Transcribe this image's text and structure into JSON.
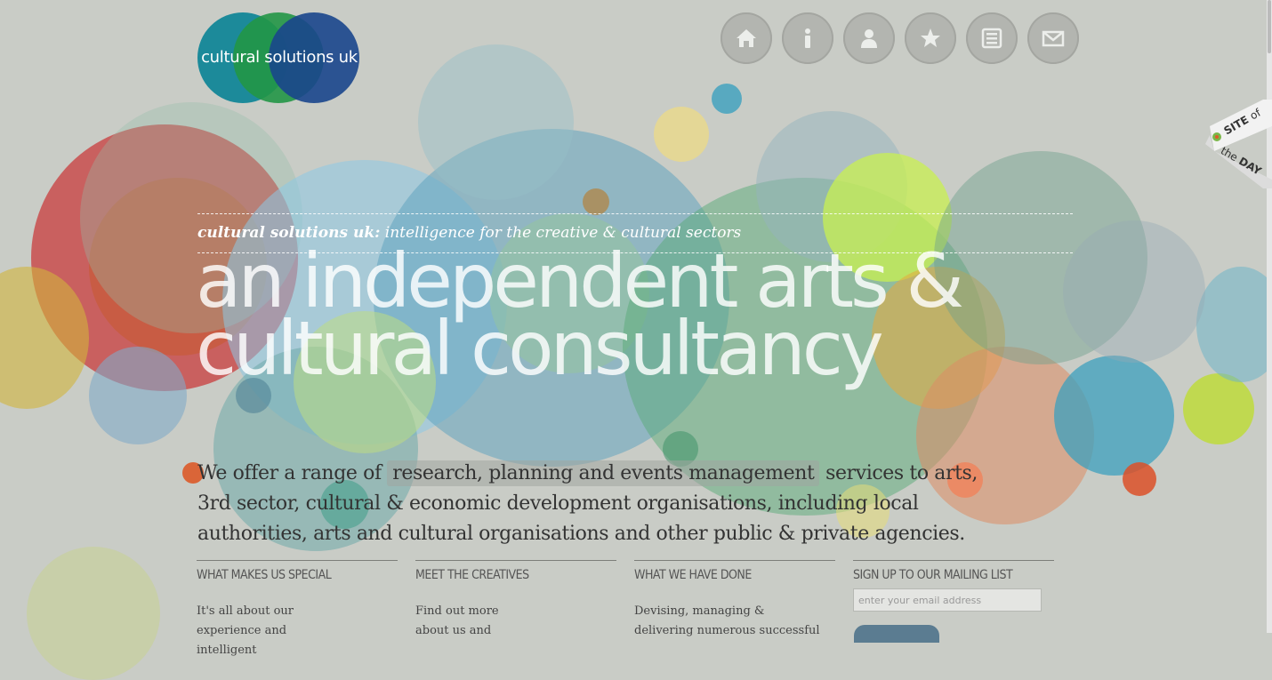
{
  "brand": {
    "name": "cultural solutions uk",
    "colors": {
      "teal": "#1c8a9a",
      "green": "#2a9a4a",
      "blue": "#1e4d8a"
    }
  },
  "nav": {
    "items": [
      {
        "name": "home",
        "icon": "home-icon"
      },
      {
        "name": "info",
        "icon": "info-icon"
      },
      {
        "name": "people",
        "icon": "user-icon"
      },
      {
        "name": "favourites",
        "icon": "star-icon"
      },
      {
        "name": "news",
        "icon": "newspaper-icon"
      },
      {
        "name": "contact",
        "icon": "envelope-icon"
      }
    ]
  },
  "badge": {
    "line1": "SITE",
    "line1b": "of",
    "line2a": "the",
    "line2b": "DAY"
  },
  "tagline": {
    "bold": "cultural solutions uk:",
    "rest": " intelligence for the creative & cultural sectors"
  },
  "headline": {
    "line1": "an independent arts &",
    "line2": "cultural consultancy"
  },
  "intro": {
    "before": "We offer a range of ",
    "highlight": "research, planning and events management",
    "after": " services to arts, 3rd sector, cultural & economic development organisations, including local authorities, arts and cultural organisations and other public & private agencies."
  },
  "columns": [
    {
      "heading": "WHAT MAKES US SPECIAL",
      "text": "It's all about our experience and intelligent"
    },
    {
      "heading": "MEET THE CREATIVES",
      "text": "Find out more about us and"
    },
    {
      "heading": "WHAT WE HAVE DONE",
      "text": "Devising, managing & delivering numerous successful"
    },
    {
      "heading": "SIGN UP TO OUR MAILING LIST",
      "text": ""
    }
  ],
  "signup": {
    "placeholder": "enter your email address"
  }
}
